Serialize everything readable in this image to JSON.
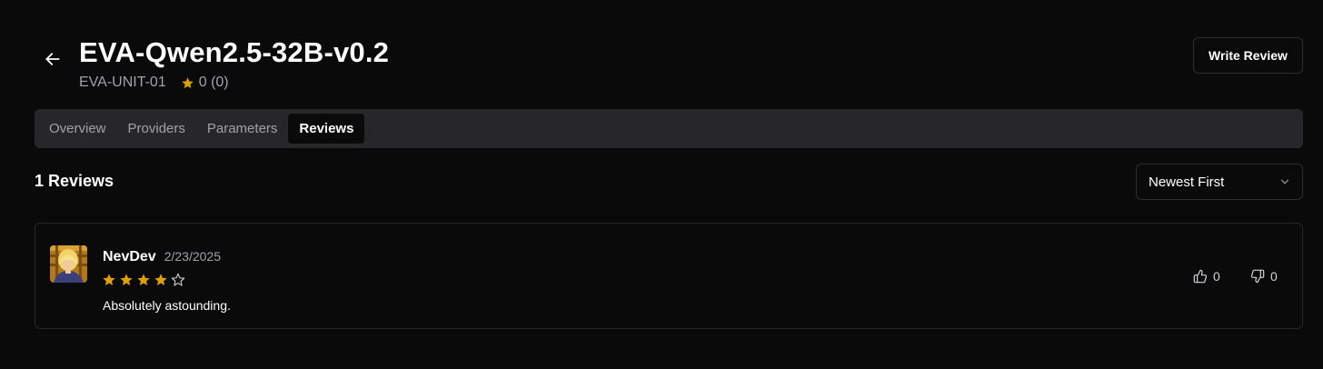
{
  "header": {
    "title": "EVA-Qwen2.5-32B-v0.2",
    "author": "EVA-UNIT-01",
    "rating_text": "0 (0)",
    "write_review_label": "Write Review",
    "back_icon": "arrow-left-icon"
  },
  "tabs": [
    {
      "label": "Overview",
      "active": false
    },
    {
      "label": "Providers",
      "active": false
    },
    {
      "label": "Parameters",
      "active": false
    },
    {
      "label": "Reviews",
      "active": true
    }
  ],
  "reviews_section": {
    "count_label": "1 Reviews",
    "sort_selected": "Newest First",
    "sort_icon": "chevron-down-icon"
  },
  "reviews": [
    {
      "author": "NevDev",
      "date": "2/23/2025",
      "stars": 4,
      "max_stars": 5,
      "text": "Absolutely astounding.",
      "upvotes": "0",
      "downvotes": "0"
    }
  ],
  "colors": {
    "background": "#0b0a0a",
    "star": "#e0a100",
    "muted_text": "#a1a1aa",
    "tab_bar": "#27272a"
  }
}
